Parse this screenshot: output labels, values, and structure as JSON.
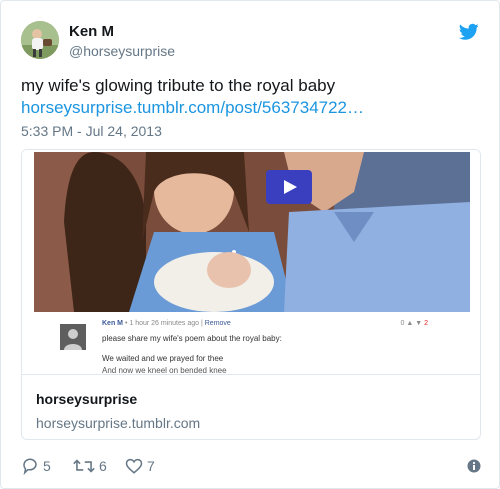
{
  "user": {
    "name": "Ken M",
    "handle": "@horseysurprise"
  },
  "tweet": {
    "text": "my wife's glowing tribute to the royal baby",
    "link": "horseysurprise.tumblr.com/post/563734722…",
    "timestamp": "5:33 PM - Jul 24, 2013"
  },
  "card": {
    "title": "horseysurprise",
    "domain": "horseysurprise.tumblr.com",
    "comment": {
      "author": "Ken M",
      "meta": "1 hour 26 minutes ago",
      "remove": "Remove",
      "votes_up": "0",
      "votes_down": "2",
      "body": "please share my wife's poem about the royal baby:",
      "line2": "We waited and we prayed for thee",
      "line3": "And now we kneel on bended knee"
    }
  },
  "actions": {
    "replies": "5",
    "retweets": "6",
    "likes": "7"
  },
  "colors": {
    "link": "#1b95e0",
    "secondary_text": "#657786",
    "border": "#e1e8ed",
    "twitter_blue": "#1da1f2"
  },
  "icons": [
    "twitter-bird-icon",
    "play-icon",
    "reply-icon",
    "retweet-icon",
    "like-icon",
    "info-icon"
  ]
}
